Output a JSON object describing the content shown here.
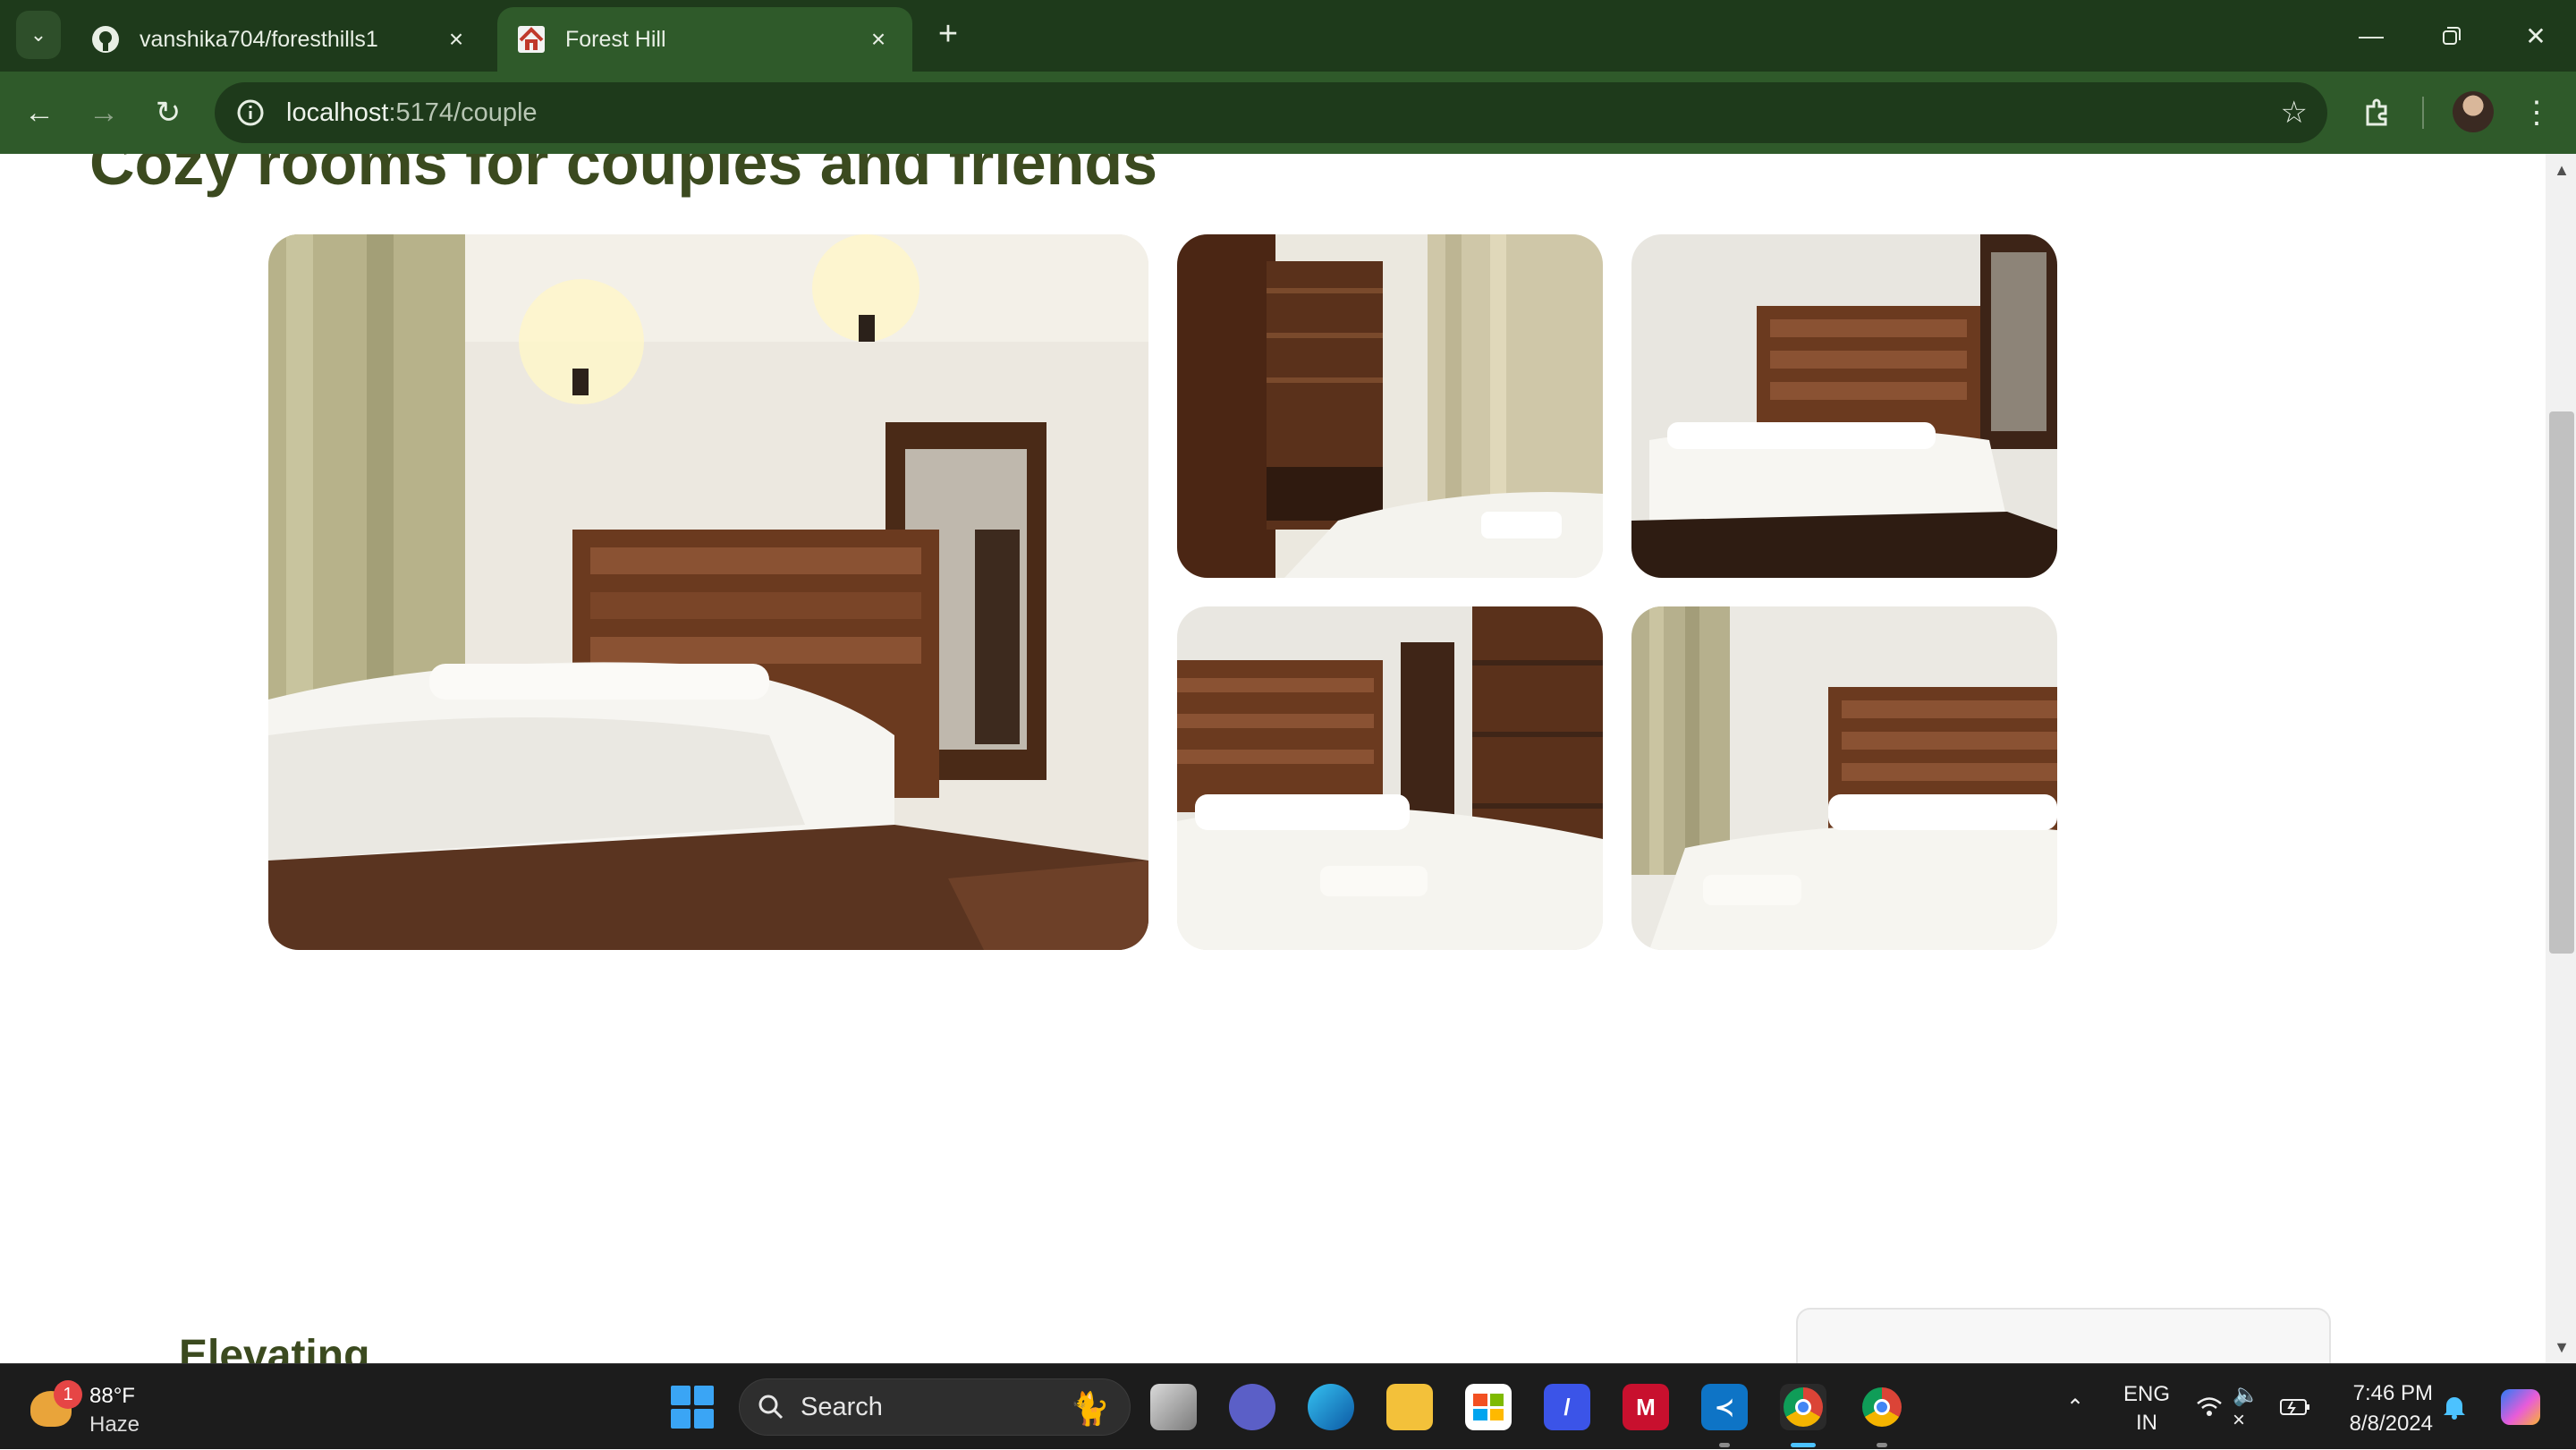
{
  "browser": {
    "tabs": [
      {
        "title": "vanshika704/foresthills1",
        "icon": "github-icon"
      },
      {
        "title": "Forest Hill",
        "icon": "house-icon",
        "active": true
      }
    ],
    "url_host": "localhost",
    "url_path": ":5174/couple"
  },
  "page": {
    "heading": "Cozy rooms for couples and friends",
    "gallery": [
      {
        "alt": "room-bed-mirror"
      },
      {
        "alt": "room-wardrobe"
      },
      {
        "alt": "room-bed-headboard"
      },
      {
        "alt": "room-bed-door"
      },
      {
        "alt": "room-bed-curtain"
      }
    ],
    "next_heading": "Elevating"
  },
  "taskbar": {
    "weather": {
      "badge": "1",
      "temp": "88°F",
      "desc": "Haze"
    },
    "search_label": "Search",
    "lang_line1": "ENG",
    "lang_line2": "IN",
    "time": "7:46 PM",
    "date": "8/8/2024"
  },
  "colors": {
    "titlebar": "#1e3a1b",
    "toolbar": "#2f5a2a",
    "heading": "#3b4a1f",
    "taskbar": "#1c1c1c"
  }
}
